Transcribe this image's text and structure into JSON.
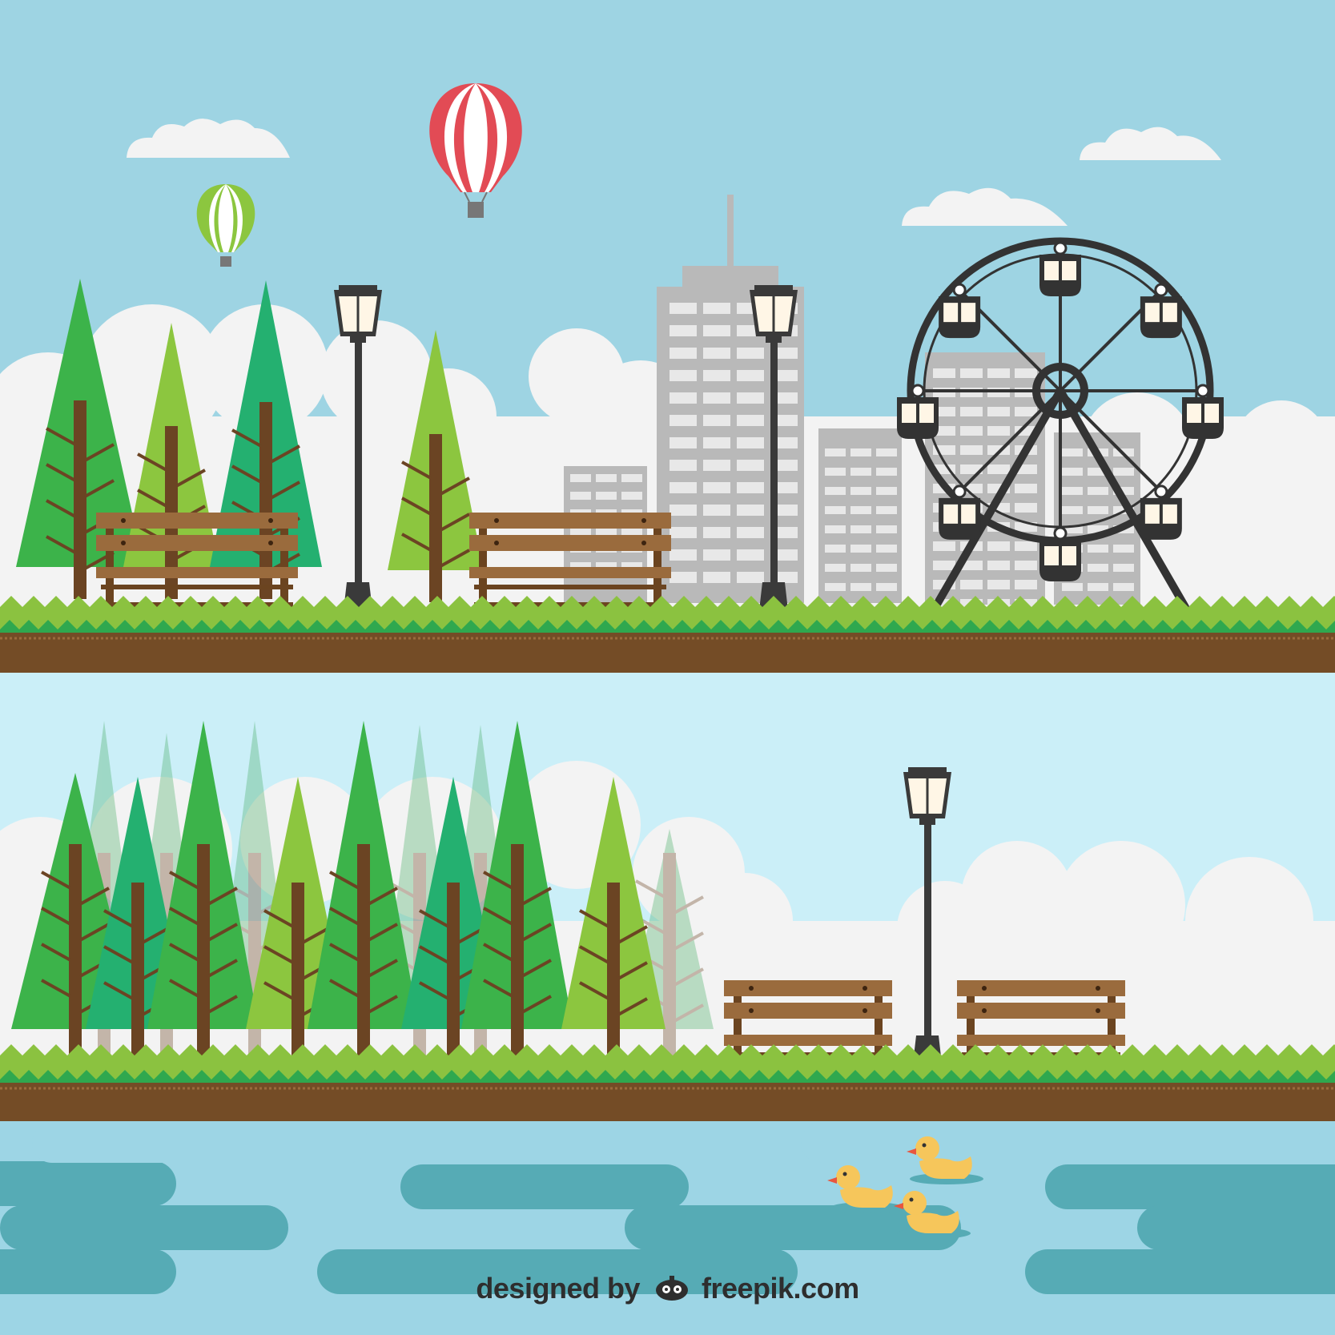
{
  "scene": {
    "top_panel": "city park with ferris wheel",
    "bottom_panel": "forest park with pond and ducks"
  },
  "watermark": {
    "prefix": "designed by",
    "brand": "freepik.com",
    "logo_icon": "freepik-logo-icon"
  },
  "colors": {
    "sky_top": "#9ed4e3",
    "sky_bottom": "#cbeff8",
    "cloud": "#f3f3f3",
    "grass_light": "#8bc240",
    "grass_dark": "#2fa84f",
    "dirt": "#744c26",
    "water_light": "#9dd5e5",
    "water_dark": "#56abb5",
    "bench_wood": "#9a6b3d",
    "bench_frame": "#6b4420",
    "lamp": "#3a3a3a",
    "lamp_glass": "#fff6e6",
    "building": "#b9b9b9",
    "window": "#e8e8e8",
    "ferris": "#333333",
    "duck": "#f6c65b",
    "tree_greens": [
      "#3cb34a",
      "#8cc63f",
      "#24b070"
    ],
    "trunk": "#6b4423",
    "balloon_red": "#e24b55",
    "balloon_green": "#8cc63f"
  }
}
